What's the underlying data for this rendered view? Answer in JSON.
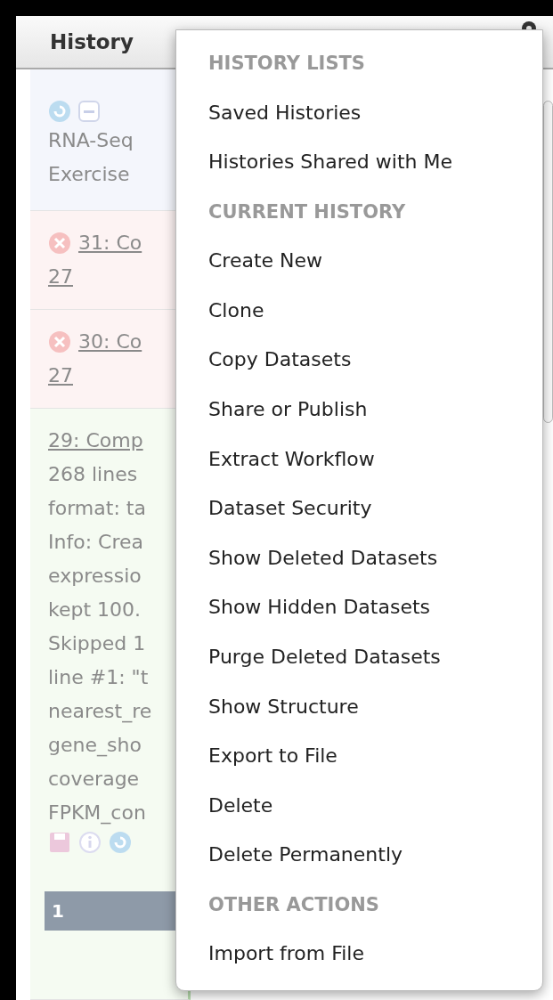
{
  "panel": {
    "title": "History"
  },
  "history_items": [
    {
      "kind": "summary",
      "lines": [
        "RNA-Seq",
        "Exercise"
      ]
    },
    {
      "kind": "error",
      "lines": [
        "31: Co",
        "27"
      ]
    },
    {
      "kind": "error",
      "lines": [
        "30: Co",
        "27"
      ]
    },
    {
      "kind": "ok",
      "lines": [
        "29: Comp",
        "268 lines",
        "format: ta",
        "Info: Crea",
        "expressio",
        "kept 100.",
        "Skipped 1",
        "line #1: \"t",
        "nearest_re",
        "gene_sho",
        "coverage",
        "FPKM_con"
      ],
      "footer": "1"
    }
  ],
  "menu": [
    {
      "kind": "header",
      "label": "HISTORY LISTS"
    },
    {
      "kind": "item",
      "label": "Saved Histories"
    },
    {
      "kind": "item",
      "label": "Histories Shared with Me"
    },
    {
      "kind": "header",
      "label": "CURRENT HISTORY"
    },
    {
      "kind": "item",
      "label": "Create New"
    },
    {
      "kind": "item",
      "label": "Clone"
    },
    {
      "kind": "item",
      "label": "Copy Datasets"
    },
    {
      "kind": "item",
      "label": "Share or Publish"
    },
    {
      "kind": "item",
      "label": "Extract Workflow"
    },
    {
      "kind": "item",
      "label": "Dataset Security"
    },
    {
      "kind": "item",
      "label": "Show Deleted Datasets"
    },
    {
      "kind": "item",
      "label": "Show Hidden Datasets"
    },
    {
      "kind": "item",
      "label": "Purge Deleted Datasets"
    },
    {
      "kind": "item",
      "label": "Show Structure"
    },
    {
      "kind": "item",
      "label": "Export to File"
    },
    {
      "kind": "item",
      "label": "Delete"
    },
    {
      "kind": "item",
      "label": "Delete Permanently"
    },
    {
      "kind": "header",
      "label": "OTHER ACTIONS"
    },
    {
      "kind": "item",
      "label": "Import from File"
    }
  ]
}
